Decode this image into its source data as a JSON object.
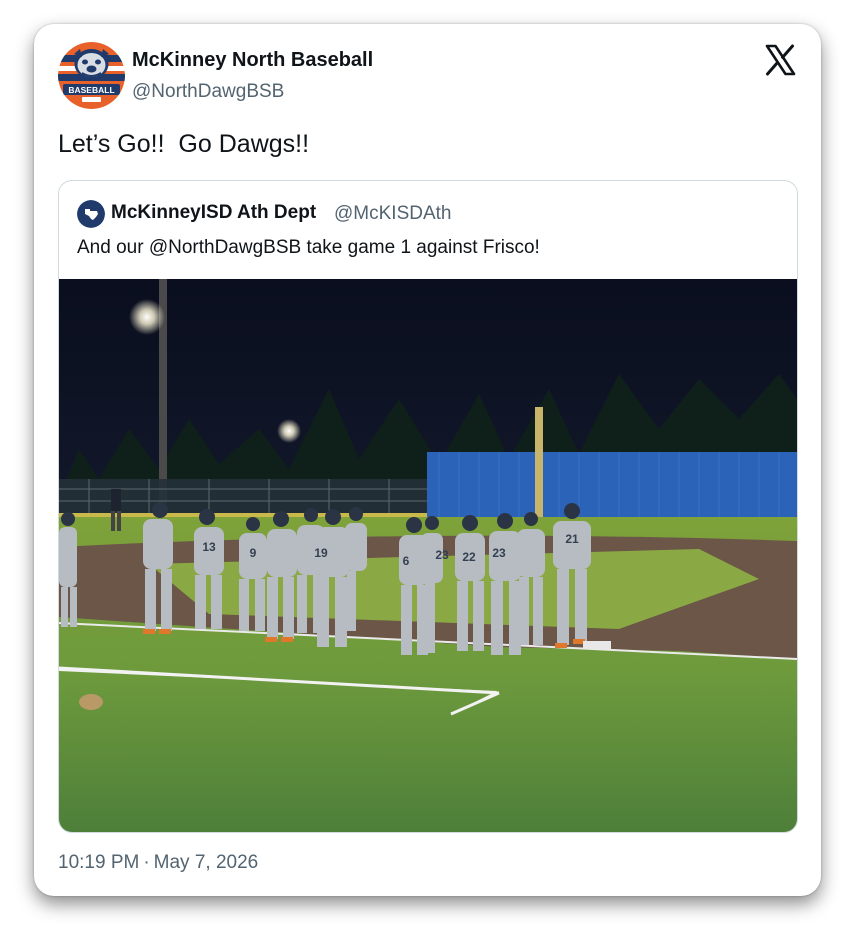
{
  "author": {
    "name": "McKinney North Baseball",
    "handle": "@NorthDawgBSB",
    "avatar_text": "BASEBALL"
  },
  "tweet": {
    "text": "Let’s Go!!  Go Dawgs!!"
  },
  "quoted_tweet": {
    "name": "McKinneyISD Ath Dept",
    "handle": "@McKISDAth",
    "text": "And our @NorthDawgBSB take game 1 against Frisco!",
    "photo": {
      "jersey_numbers": [
        "13",
        "9",
        "19",
        "6",
        "23",
        "22",
        "23",
        "21"
      ]
    }
  },
  "meta": {
    "time": "10:19 PM",
    "separator": "·",
    "date": "May 7, 2026"
  },
  "icons": {
    "platform": "x-logo-icon"
  },
  "colors": {
    "text_primary": "#0f1419",
    "text_secondary": "#536471",
    "border": "#cfd9de",
    "avatar_orange": "#e8602a",
    "avatar_navy": "#1f3a6b"
  }
}
